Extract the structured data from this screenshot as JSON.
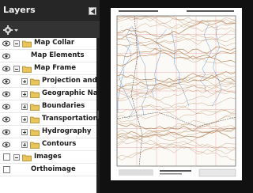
{
  "panel": {
    "title": "Layers",
    "collapse_icon": "triangle-left-icon",
    "options_icon": "gear-dropdown-icon"
  },
  "layers": [
    {
      "label": "Map Collar",
      "visible": true,
      "expandable": true,
      "expanded": true,
      "folder": true
    },
    {
      "label": "Map Elements",
      "visible": true,
      "expandable": false,
      "expanded": false,
      "folder": false
    },
    {
      "label": "Map Frame",
      "visible": true,
      "expandable": true,
      "expanded": true,
      "folder": true
    },
    {
      "label": "Projection and Gr",
      "visible": true,
      "expandable": true,
      "expanded": false,
      "folder": true
    },
    {
      "label": "Geographic Name",
      "visible": true,
      "expandable": true,
      "expanded": false,
      "folder": true
    },
    {
      "label": "Boundaries",
      "visible": true,
      "expandable": true,
      "expanded": false,
      "folder": true
    },
    {
      "label": "Transportation",
      "visible": true,
      "expandable": true,
      "expanded": false,
      "folder": true
    },
    {
      "label": "Hydrography",
      "visible": true,
      "expandable": true,
      "expanded": false,
      "folder": true
    },
    {
      "label": "Contours",
      "visible": true,
      "expandable": true,
      "expanded": false,
      "folder": true
    },
    {
      "label": "Images",
      "visible": false,
      "expandable": true,
      "expanded": true,
      "folder": true
    },
    {
      "label": "Orthoimage",
      "visible": false,
      "expandable": false,
      "expanded": false,
      "folder": false
    }
  ],
  "colors": {
    "panel_bg": "#2b2b2b",
    "folder": "#e8c45a",
    "contour": "#b5845a",
    "water": "#4f86c6",
    "grid": "#e06060"
  }
}
